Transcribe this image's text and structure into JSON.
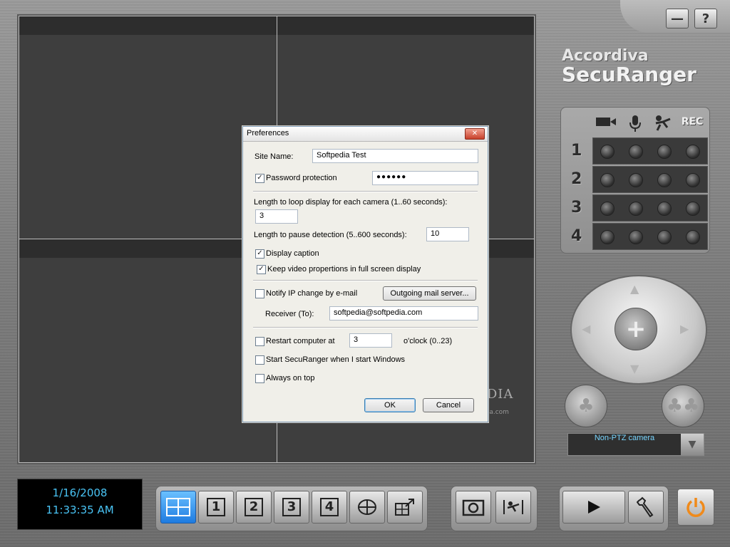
{
  "brand": {
    "line1": "Accordiva",
    "line2": "SecuRanger"
  },
  "window_controls": {
    "minimize_label": "—",
    "help_label": "?"
  },
  "status_panel": {
    "rec_label": "REC",
    "rows": [
      "1",
      "2",
      "3",
      "4"
    ]
  },
  "camera_select": {
    "value": "Non-PTZ camera"
  },
  "datetime": {
    "date": "1/16/2008",
    "time": "11:33:35 AM"
  },
  "toolbar": {
    "view_buttons": [
      "1",
      "2",
      "3",
      "4"
    ]
  },
  "colors": {
    "accent": "#1e7be0",
    "clock_text": "#49c4f5",
    "power": "#f08a1a"
  },
  "icons": {
    "video_camera": "video-camera-icon",
    "microphone": "microphone-icon",
    "motion": "motion-icon",
    "snapshot": "snapshot-icon",
    "settings": "wrench-icon",
    "play": "play-icon",
    "power": "power-icon"
  },
  "dialog": {
    "title": "Preferences",
    "close_label": "✕",
    "site_name_label": "Site Name:",
    "site_name_value": "Softpedia Test",
    "password_protection_label": "Password protection",
    "password_protection_checked": true,
    "password_value": "●●●●●●",
    "loop_label": "Length to loop display for each camera (1..60 seconds):",
    "loop_value": "3",
    "pause_label": "Length to pause detection (5..600 seconds):",
    "pause_value": "10",
    "display_caption_label": "Display caption",
    "display_caption_checked": true,
    "keep_proportions_label": "Keep video propertions in full screen display",
    "keep_proportions_checked": true,
    "notify_ip_label": "Notify IP change by e-mail",
    "notify_ip_checked": false,
    "mail_server_button": "Outgoing mail server...",
    "receiver_label": "Receiver (To):",
    "receiver_value": "softpedia@softpedia.com",
    "restart_label": "Restart computer at",
    "restart_checked": false,
    "restart_value": "3",
    "restart_unit": "o'clock (0..23)",
    "start_with_windows_label": "Start SecuRanger when I start Windows",
    "start_with_windows_checked": false,
    "always_on_top_label": "Always on top",
    "always_on_top_checked": false,
    "ok_label": "OK",
    "cancel_label": "Cancel"
  },
  "watermark": {
    "text": "SOFTPEDIA",
    "sub": "www.softpedia.com"
  }
}
